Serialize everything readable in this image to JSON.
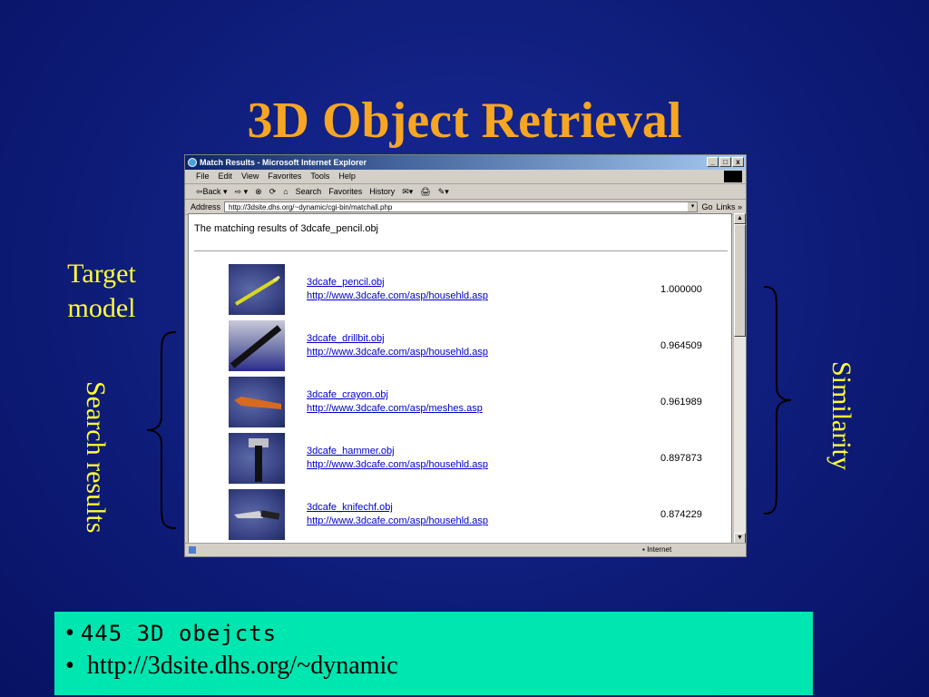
{
  "slide": {
    "title": "3D Object Retrieval",
    "target_label_line1": "Target",
    "target_label_line2": "model",
    "search_label": "Search results",
    "similarity_label": "Similarity",
    "bullets": [
      "445 3D obejcts",
      "http://3dsite.dhs.org/~dynamic"
    ]
  },
  "browser": {
    "title": "Match Results - Microsoft Internet Explorer",
    "window_buttons": [
      "_",
      "□",
      "x"
    ],
    "menu": [
      "File",
      "Edit",
      "View",
      "Favorites",
      "Tools",
      "Help"
    ],
    "toolbar": [
      "⇦Back ▾",
      "⇨ ▾",
      "⊗",
      "⟳",
      "⌂",
      "Search",
      "Favorites",
      "History",
      "✉▾",
      "🖨",
      "✎▾"
    ],
    "address_label": "Address",
    "address_value": "http://3dsite.dhs.org/~dynamic/cgi-bin/matchall.php",
    "go_label": "Go",
    "links_label": "Links »",
    "page_heading": "The matching results of 3dcafe_pencil.obj",
    "results": [
      {
        "name": "3dcafe_pencil.obj",
        "url": "http://www.3dcafe.com/asp/househld.asp",
        "score": "1.000000",
        "thumb": "pencil"
      },
      {
        "name": "3dcafe_drillbit.obj",
        "url": "http://www.3dcafe.com/asp/househld.asp",
        "score": "0.964509",
        "thumb": "drillbit"
      },
      {
        "name": "3dcafe_crayon.obj",
        "url": "http://www.3dcafe.com/asp/meshes.asp",
        "score": "0.961989",
        "thumb": "crayon"
      },
      {
        "name": "3dcafe_hammer.obj",
        "url": "http://www.3dcafe.com/asp/househld.asp",
        "score": "0.897873",
        "thumb": "hammer"
      },
      {
        "name": "3dcafe_knifechf.obj",
        "url": "http://www.3dcafe.com/asp/househld.asp",
        "score": "0.874229",
        "thumb": "knife"
      }
    ],
    "status_zone": "Internet"
  },
  "colors": {
    "title": "#f6a623",
    "labels": "#ffff33",
    "background": "#101f7e",
    "infobox": "#00e6b0"
  }
}
